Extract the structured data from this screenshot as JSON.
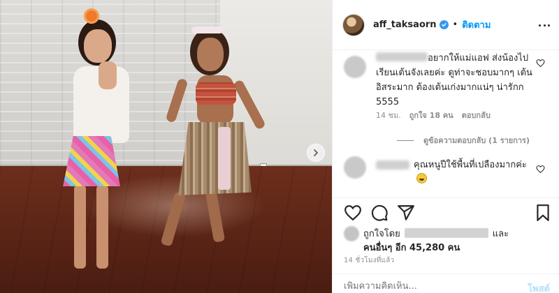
{
  "header": {
    "username": "aff_taksaorn",
    "follow_label": "ติดตาม",
    "separator": "•"
  },
  "comments": [
    {
      "text": "อยากให้แม่แอฟ ส่งน้องไปเรียนเต้นจังเลยค่ะ ดูท่าจะชอบมากๆ เต้นอิสระมาก ต้องเต้นเก่งมากแน่ๆ น่ารักก 5555",
      "age": "14 ชม.",
      "likes": "ถูกใจ 18 คน",
      "reply_label": "ตอบกลับ",
      "view_replies": "ดูข้อความตอบกลับ (1 รายการ)"
    },
    {
      "text": "คุณหนูปีใช้พื้นที่เปลืองมากค่ะ"
    }
  ],
  "likes": {
    "liked_by": "ถูกใจโดย",
    "and": "และ",
    "others": "คนอื่นๆ อีก 45,280 คน"
  },
  "timestamp": "14 ชั่วโมงที่แล้ว",
  "add_comment": {
    "placeholder": "เพิ่มความคิดเห็น...",
    "post_label": "โพสต์"
  },
  "icons": {
    "like": "heart-icon",
    "comment": "comment-icon",
    "share": "share-icon",
    "save": "bookmark-icon",
    "next": "chevron-right-icon",
    "more": "more-icon",
    "verified": "verified-badge-icon"
  },
  "colors": {
    "accent": "#0095f6",
    "verified": "#3897f0",
    "muted": "#8e8e8e",
    "post_disabled": "#b2dffc"
  }
}
